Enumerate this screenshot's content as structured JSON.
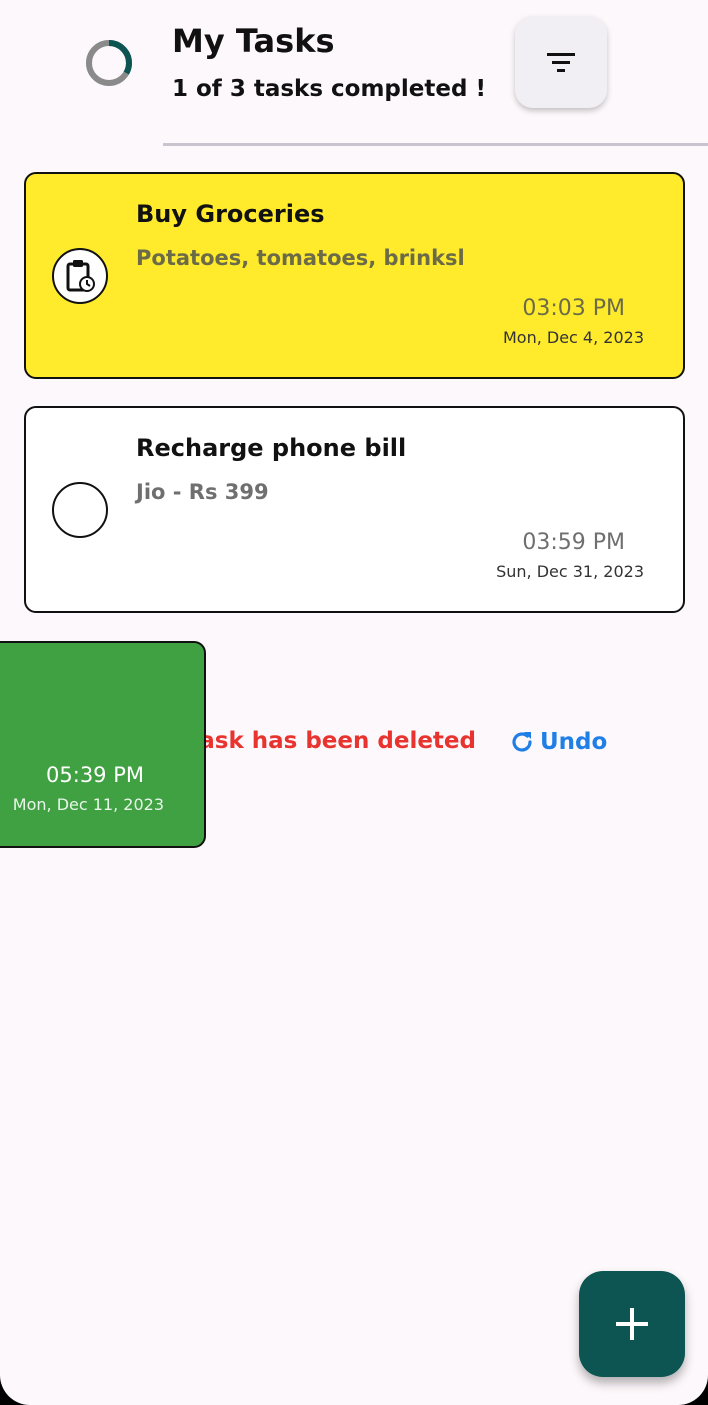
{
  "header": {
    "title": "My Tasks",
    "subtitle": "1 of 3 tasks completed !",
    "progress_fraction": 0.3333,
    "progress_color": "#0c5553",
    "progress_track_color": "#8a8a8a",
    "filter_icon": "filter-icon"
  },
  "tasks": [
    {
      "title": "Buy Groceries",
      "description": "Potatoes, tomatoes, brinksl",
      "time": "03:03 PM",
      "date": "Mon, Dec 4, 2023",
      "color": "#ffeb2c",
      "status_icon": "clipboard-clock-icon"
    },
    {
      "title": "Recharge phone bill",
      "description": "Jio - Rs 399",
      "time": "03:59 PM",
      "date": "Sun, Dec 31, 2023",
      "color": "#ffffff",
      "status_icon": "empty-circle-icon"
    }
  ],
  "swiped_task": {
    "time": "05:39 PM",
    "date": "Mon, Dec 11, 2023",
    "color": "#3fa142"
  },
  "snackbar": {
    "message": "Task has been deleted",
    "undo_label": "Undo",
    "undo_icon": "refresh-icon",
    "message_color": "#e8332e",
    "undo_color": "#1f7fe6"
  },
  "fab": {
    "icon": "plus-icon",
    "color": "#0c5553"
  }
}
